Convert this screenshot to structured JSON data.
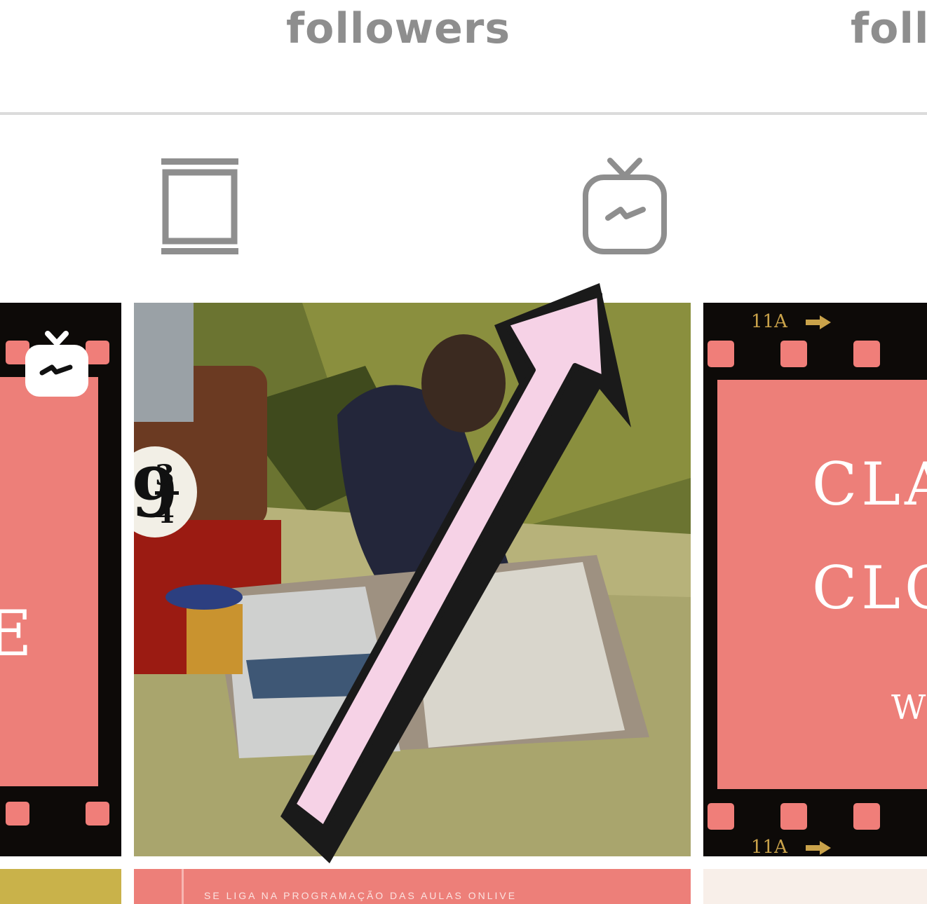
{
  "profile": {
    "stats": [
      {
        "label": "followers"
      },
      {
        "label": "foll"
      }
    ]
  },
  "tabs": [
    {
      "name": "posts",
      "icon": "feed-grid-icon"
    },
    {
      "name": "igtv",
      "icon": "igtv-icon"
    }
  ],
  "grid": {
    "tile_left": {
      "badge_icon": "igtv-badge-icon",
      "partial_letter": "E"
    },
    "tile_center": {
      "platform_sign": {
        "top": "3",
        "bottom": "4",
        "prefix": "9"
      },
      "annotation": "pink-arrow-pointing-to-igtv-icon"
    },
    "tile_right": {
      "frame_number": "11A",
      "lines": [
        "CLA",
        "CLO",
        "W"
      ]
    },
    "row2_center_text": "SE LIGA NA PROGRAMAÇÃO DAS AULAS ONLIVE"
  },
  "colors": {
    "salmon": "#ed7f79",
    "film_black": "#0d0a08",
    "arrow_pink": "#f6d2e6",
    "icon_gray": "#8e8e8e"
  }
}
